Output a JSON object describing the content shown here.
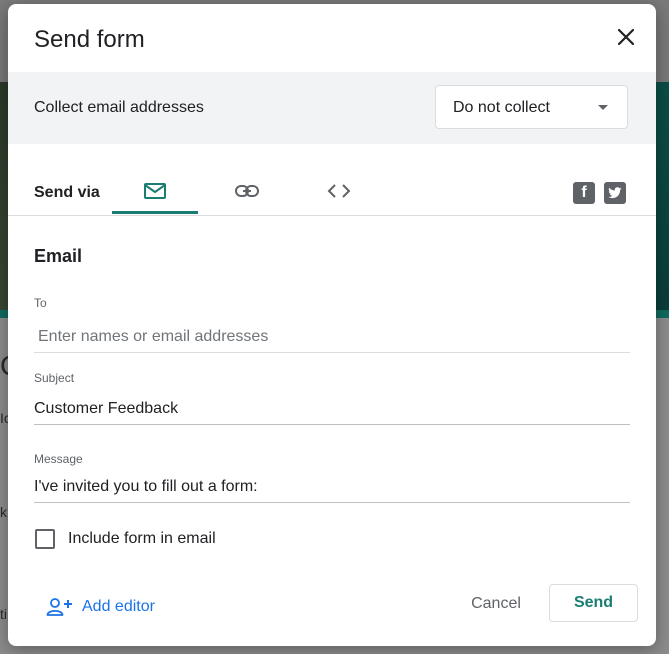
{
  "dialog": {
    "title": "Send form",
    "collect": {
      "label": "Collect email addresses",
      "selected": "Do not collect"
    },
    "send_via": {
      "label": "Send via",
      "tabs": [
        {
          "icon": "email-icon",
          "active": true
        },
        {
          "icon": "link-icon",
          "active": false
        },
        {
          "icon": "embed-code-icon",
          "active": false
        }
      ],
      "social": [
        "facebook-icon",
        "twitter-icon"
      ]
    },
    "email": {
      "section_title": "Email",
      "to_label": "To",
      "to_placeholder": "Enter names or email addresses",
      "to_value": "",
      "subject_label": "Subject",
      "subject_value": "Customer Feedback",
      "message_label": "Message",
      "message_value": "I've invited you to fill out a form:",
      "include_form_label": "Include form in email",
      "include_form_checked": false
    },
    "footer": {
      "add_editor_label": "Add editor",
      "cancel_label": "Cancel",
      "send_label": "Send"
    }
  },
  "background": {
    "fragments": [
      "C",
      "Ic",
      "k",
      "ti"
    ]
  },
  "colors": {
    "accent": "#1a7d72",
    "link": "#1a73e8",
    "gray_bar": "#f1f3f4"
  }
}
